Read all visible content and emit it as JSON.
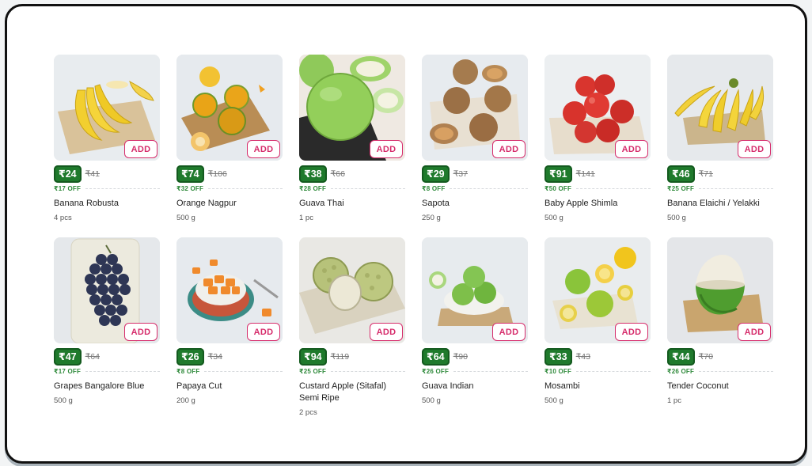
{
  "add_label": "ADD",
  "products": [
    {
      "name": "Banana Robusta",
      "price": "₹24",
      "mrp": "₹41",
      "off": "₹17 OFF",
      "qty": "4 pcs",
      "icon": "banana-image"
    },
    {
      "name": "Orange Nagpur",
      "price": "₹74",
      "mrp": "₹106",
      "off": "₹32 OFF",
      "qty": "500 g",
      "icon": "orange-image"
    },
    {
      "name": "Guava Thai",
      "price": "₹38",
      "mrp": "₹66",
      "off": "₹28 OFF",
      "qty": "1 pc",
      "icon": "guava-image"
    },
    {
      "name": "Sapota",
      "price": "₹29",
      "mrp": "₹37",
      "off": "₹8 OFF",
      "qty": "250 g",
      "icon": "sapota-image"
    },
    {
      "name": "Baby Apple Shimla",
      "price": "₹91",
      "mrp": "₹141",
      "off": "₹50 OFF",
      "qty": "500 g",
      "icon": "apple-image"
    },
    {
      "name": "Banana Elaichi / Yelakki",
      "price": "₹46",
      "mrp": "₹71",
      "off": "₹25 OFF",
      "qty": "500 g",
      "icon": "banana-elaichi-image"
    },
    {
      "name": "Grapes Bangalore Blue",
      "price": "₹47",
      "mrp": "₹64",
      "off": "₹17 OFF",
      "qty": "500 g",
      "icon": "grapes-image"
    },
    {
      "name": "Papaya Cut",
      "price": "₹26",
      "mrp": "₹34",
      "off": "₹8 OFF",
      "qty": "200 g",
      "icon": "papaya-image"
    },
    {
      "name": "Custard Apple (Sitafal) Semi Ripe",
      "price": "₹94",
      "mrp": "₹119",
      "off": "₹25 OFF",
      "qty": "2 pcs",
      "icon": "custard-apple-image"
    },
    {
      "name": "Guava Indian",
      "price": "₹64",
      "mrp": "₹90",
      "off": "₹26 OFF",
      "qty": "500 g",
      "icon": "guava-indian-image"
    },
    {
      "name": "Mosambi",
      "price": "₹33",
      "mrp": "₹43",
      "off": "₹10 OFF",
      "qty": "500 g",
      "icon": "mosambi-image"
    },
    {
      "name": "Tender Coconut",
      "price": "₹44",
      "mrp": "₹70",
      "off": "₹26 OFF",
      "qty": "1 pc",
      "icon": "coconut-image"
    }
  ]
}
